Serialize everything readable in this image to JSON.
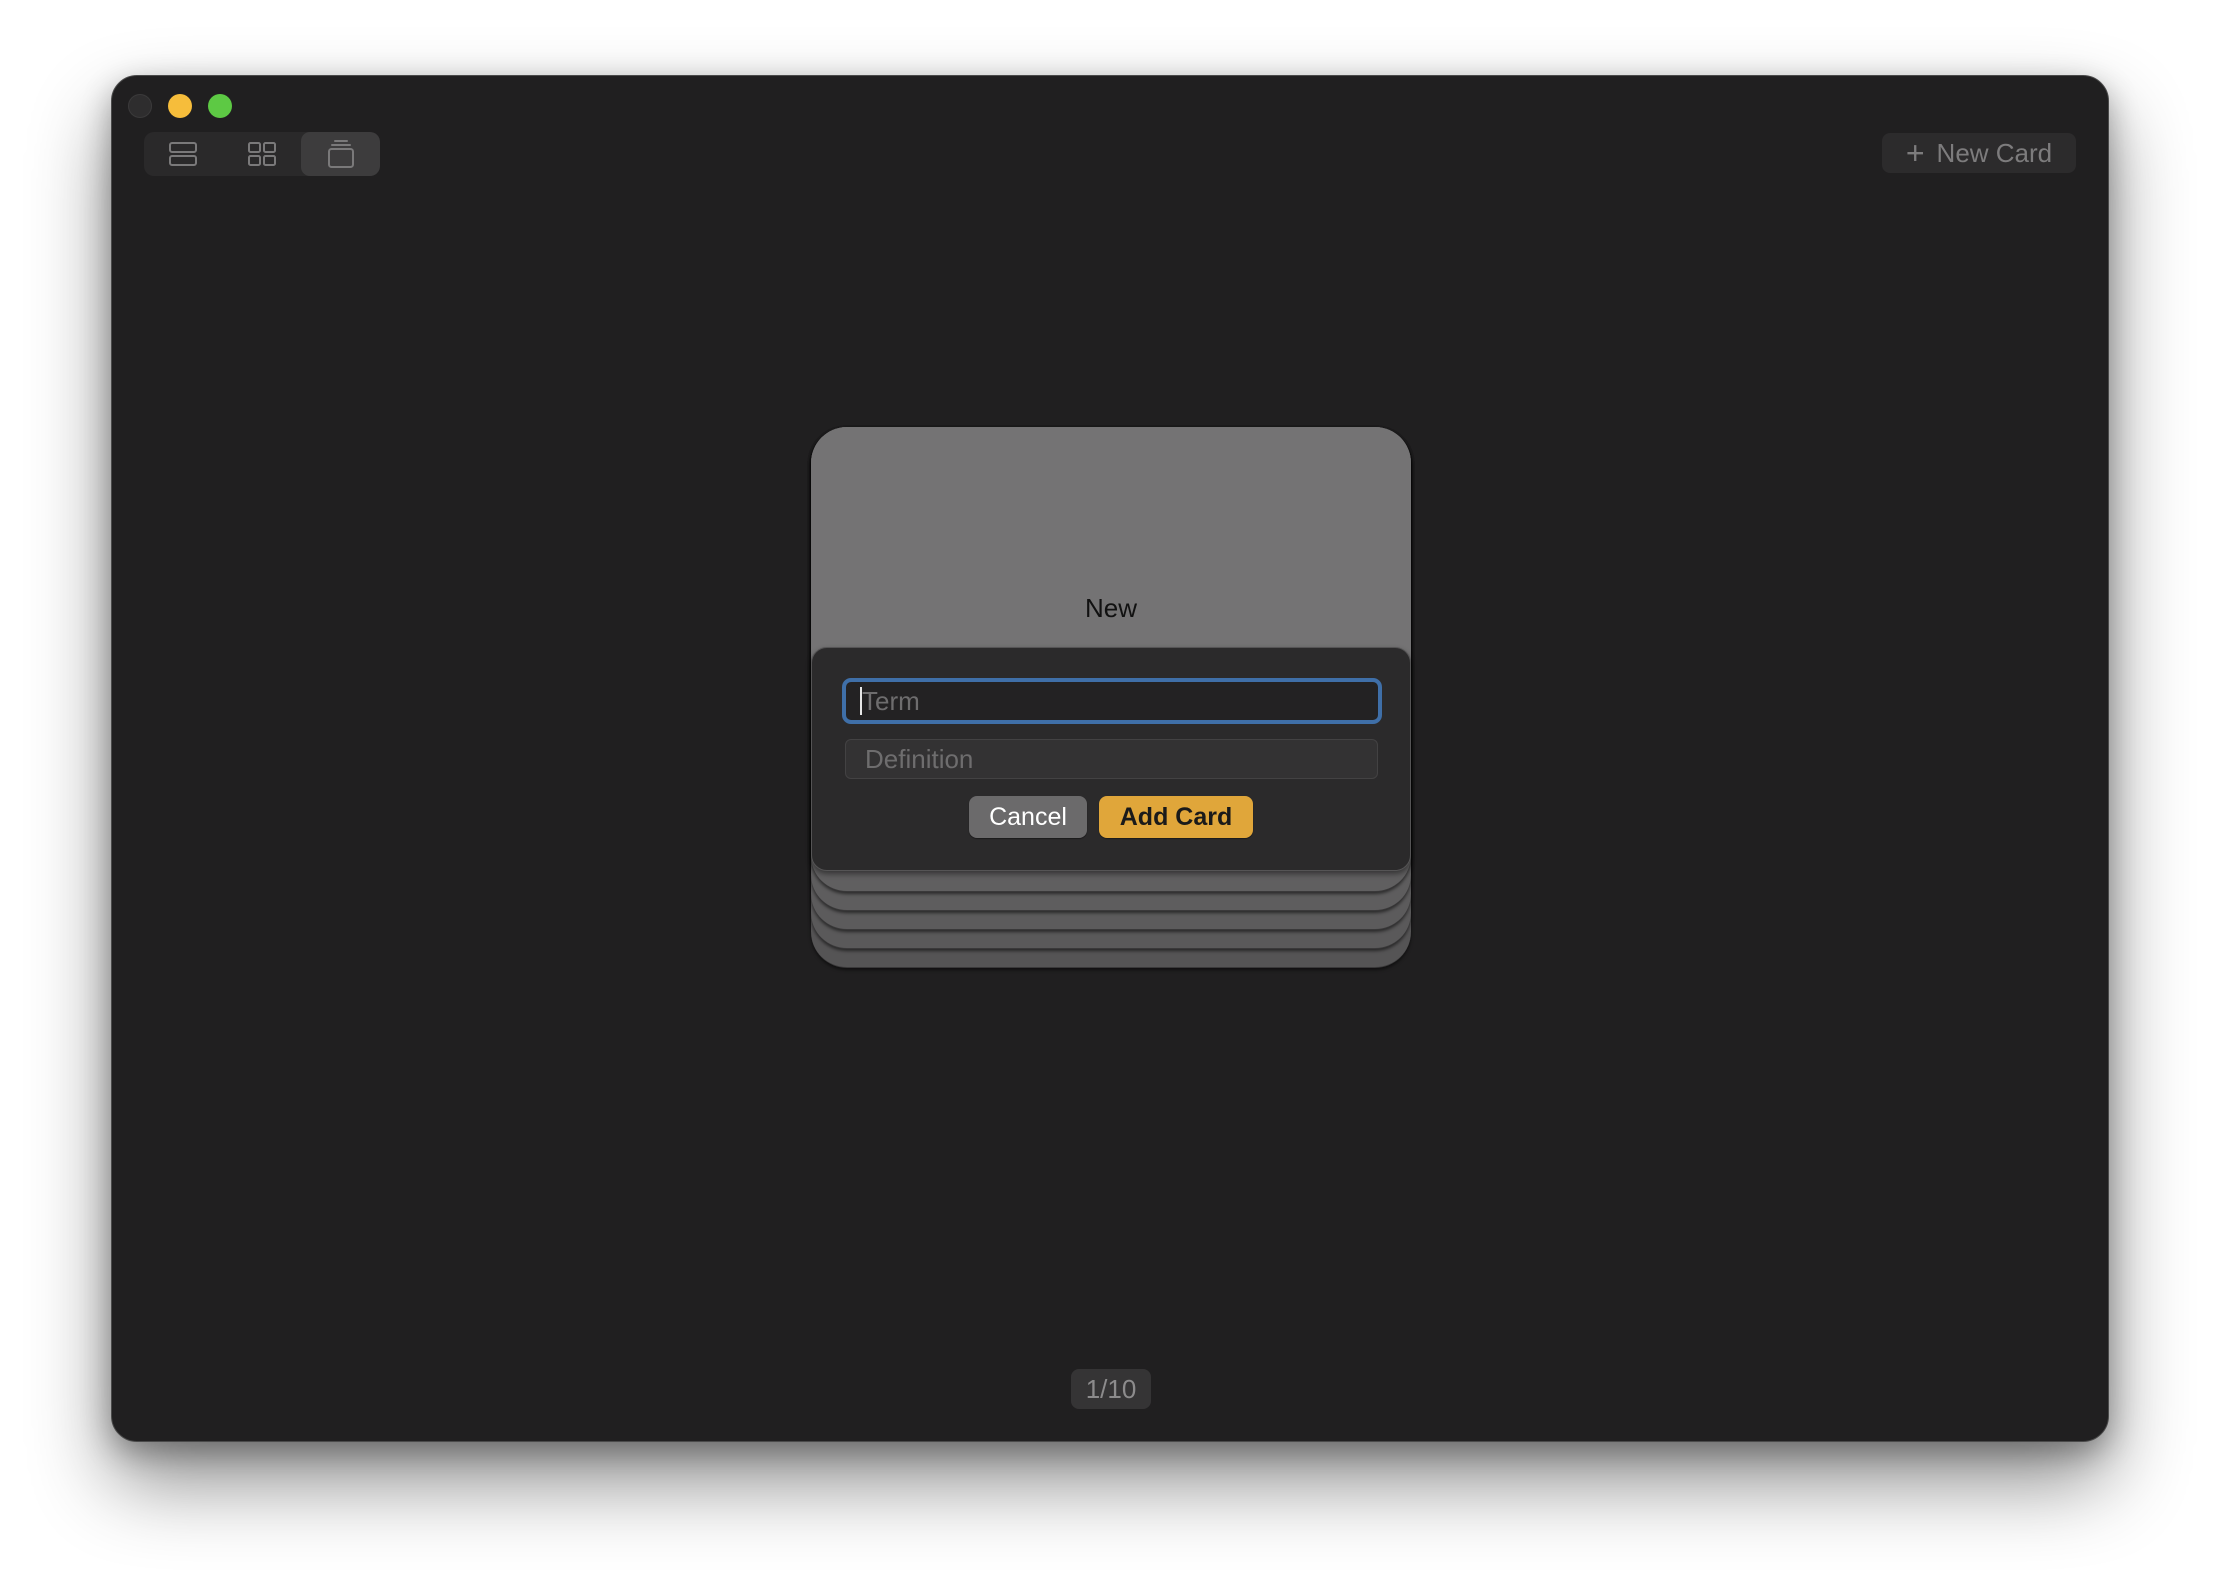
{
  "window": {
    "traffic_lights": [
      "close",
      "minimize",
      "zoom"
    ]
  },
  "toolbar": {
    "view_modes": [
      {
        "name": "list-view",
        "icon": "rows-icon",
        "active": false
      },
      {
        "name": "grid-view",
        "icon": "grid-icon",
        "active": false
      },
      {
        "name": "stack-view",
        "icon": "card-stack-icon",
        "active": true
      }
    ],
    "new_card_icon": "plus-icon",
    "new_card_label": "New Card"
  },
  "card": {
    "title": "New",
    "term_placeholder": "Term",
    "term_value": "",
    "definition_placeholder": "Definition",
    "definition_value": "",
    "cancel_label": "Cancel",
    "add_label": "Add Card"
  },
  "pagination": {
    "label": "1/10"
  },
  "colors": {
    "window_bg": "#201f20",
    "accent": "#e0a63a",
    "focus_ring": "#3f6fa8",
    "card_top": "#747374"
  }
}
